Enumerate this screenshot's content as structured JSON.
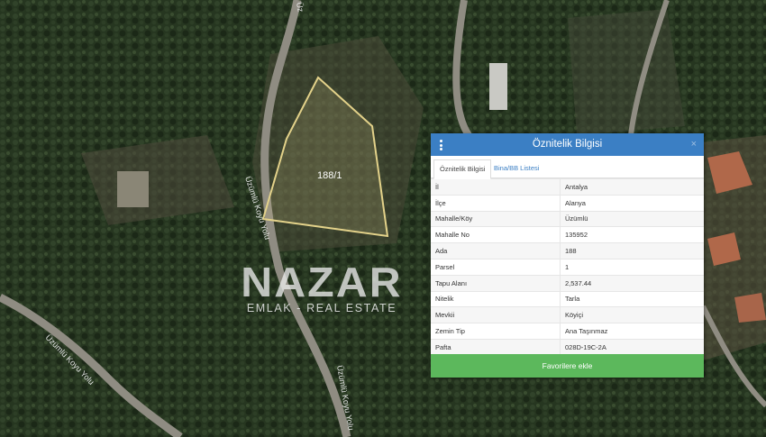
{
  "map": {
    "parcel_label": "188/1",
    "road_labels": [
      "Üzümlü Koyu Yolu",
      "Üzümlü Koyu Yolu",
      "Üzümlü Koyu Yolu",
      "Üz"
    ]
  },
  "logo": {
    "title": "NAZAR",
    "subtitle": "EMLAK - REAL ESTATE"
  },
  "panel": {
    "title": "Öznitelik Bilgisi",
    "close_symbol": "×",
    "tabs": [
      {
        "label": "Öznitelik Bilgisi",
        "active": true
      },
      {
        "label": "Bina/BB Listesi",
        "active": false
      }
    ],
    "rows": [
      {
        "key": "İl",
        "value": "Antalya"
      },
      {
        "key": "İlçe",
        "value": "Alanya"
      },
      {
        "key": "Mahalle/Köy",
        "value": "Üzümlü"
      },
      {
        "key": "Mahalle No",
        "value": "135952"
      },
      {
        "key": "Ada",
        "value": "188"
      },
      {
        "key": "Parsel",
        "value": "1"
      },
      {
        "key": "Tapu Alanı",
        "value": "2,537.44"
      },
      {
        "key": "Nitelik",
        "value": "Tarla"
      },
      {
        "key": "Mevkii",
        "value": "Köyiçi"
      },
      {
        "key": "Zemin Tip",
        "value": "Ana Taşınmaz"
      },
      {
        "key": "Pafta",
        "value": "028D-19C-2A"
      }
    ],
    "button_label": "Favorilere ekle"
  },
  "colors": {
    "header": "#3b7fc4",
    "button": "#5cb85c",
    "parcel_outline": "#e3d28a"
  }
}
